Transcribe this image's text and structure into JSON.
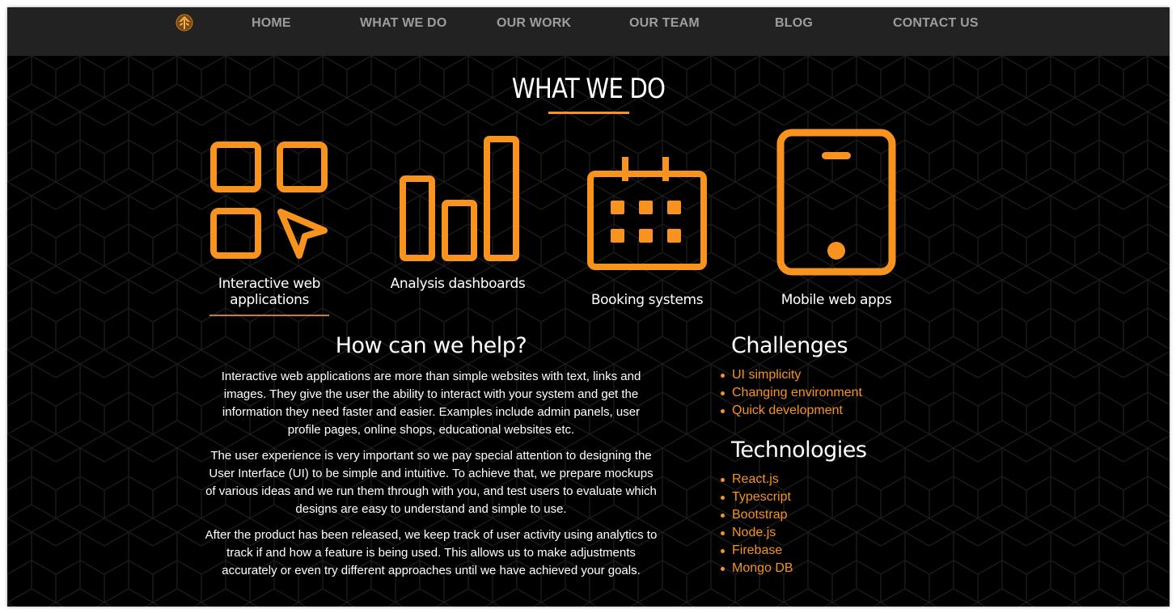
{
  "colors": {
    "accent": "#f7931e",
    "navbar_bg": "#222222",
    "nav_text": "#9d9d9d",
    "page_bg": "#000000",
    "text": "#ffffff"
  },
  "navbar": {
    "logo": "logo-icon",
    "items": [
      {
        "label": "HOME"
      },
      {
        "label": "WHAT WE DO"
      },
      {
        "label": "OUR WORK"
      },
      {
        "label": "OUR TEAM"
      },
      {
        "label": "BLOG"
      },
      {
        "label": "CONTACT US"
      }
    ]
  },
  "section": {
    "title": "WHAT WE DO"
  },
  "services": [
    {
      "icon": "grid-cursor-icon",
      "label": "Interactive web applications",
      "active": true
    },
    {
      "icon": "bar-chart-icon",
      "label": "Analysis dashboards",
      "active": false
    },
    {
      "icon": "calendar-icon",
      "label": "Booking systems",
      "active": false
    },
    {
      "icon": "tablet-icon",
      "label": "Mobile web apps",
      "active": false
    }
  ],
  "help": {
    "title": "How can we help?",
    "paragraphs": [
      "Interactive web applications are more than simple websites with text, links and images. They give the user the ability to interact with your system and get the information they need faster and easier. Examples include admin panels, user profile pages, online shops, educational websites etc.",
      "The user experience is very important so we pay special attention to designing the User Interface (UI) to be simple and intuitive. To achieve that, we prepare mockups of various ideas and we run them through with you, and test users to evaluate which designs are easy to understand and simple to use.",
      "After the product has been released, we keep track of user activity using analytics to track if and how a feature is being used. This allows us to make adjustments accurately or even try different approaches until we have achieved your goals."
    ]
  },
  "challenges": {
    "title": "Challenges",
    "items": [
      "UI simplicity",
      "Changing environment",
      "Quick development"
    ]
  },
  "technologies": {
    "title": "Technologies",
    "items": [
      "React.js",
      "Typescript",
      "Bootstrap",
      "Node.js",
      "Firebase",
      "Mongo DB"
    ]
  }
}
